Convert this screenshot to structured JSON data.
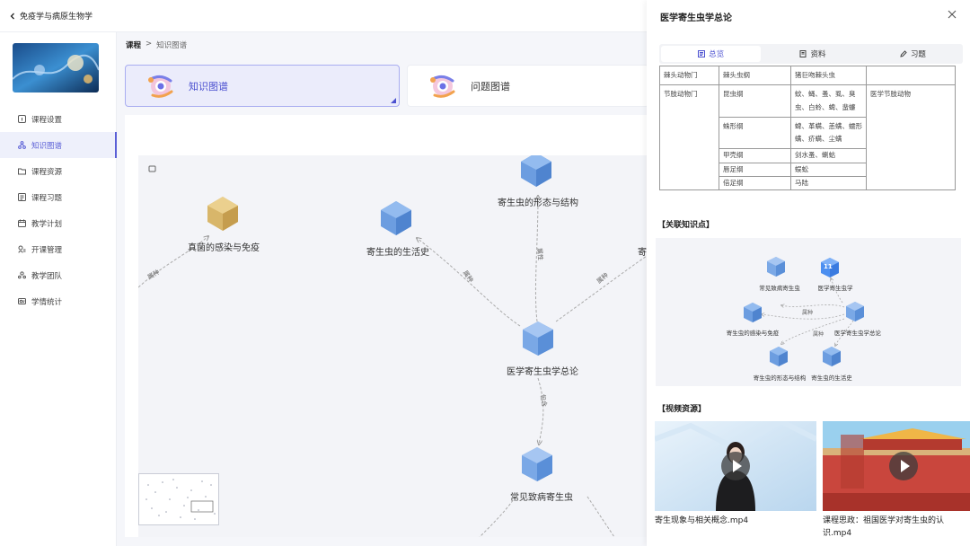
{
  "topbar": {
    "back_label": "免疫学与病原生物学"
  },
  "sidebar": {
    "items": [
      {
        "label": "课程设置",
        "icon": "info-square-icon"
      },
      {
        "label": "知识图谱",
        "icon": "graph-nodes-icon",
        "active": true
      },
      {
        "label": "课程资源",
        "icon": "folder-icon"
      },
      {
        "label": "课程习题",
        "icon": "list-doc-icon"
      },
      {
        "label": "教学计划",
        "icon": "calendar-icon"
      },
      {
        "label": "开课管理",
        "icon": "manage-icon"
      },
      {
        "label": "教学团队",
        "icon": "team-icon"
      },
      {
        "label": "学情统计",
        "icon": "stats-icon"
      }
    ]
  },
  "main": {
    "breadcrumb": [
      "课程",
      ">",
      "知识图谱"
    ],
    "cards": [
      {
        "label": "知识图谱",
        "active": true
      },
      {
        "label": "问题图谱"
      }
    ],
    "graph": {
      "nodes": [
        {
          "label": "真菌的感染与免疫"
        },
        {
          "label": "寄生虫的生活史"
        },
        {
          "label": "寄生虫的形态与结构"
        },
        {
          "label": "寄生"
        },
        {
          "label": "医学寄生虫学总论"
        },
        {
          "label": "常见致病寄生虫"
        }
      ],
      "edges": [
        "属种",
        "属种",
        "属性",
        "属种",
        "包含"
      ]
    }
  },
  "panel": {
    "title": "医学寄生虫学总论",
    "tabs": [
      {
        "label": "总览",
        "icon": "overview-icon",
        "active": true
      },
      {
        "label": "资料",
        "icon": "book-icon"
      },
      {
        "label": "习题",
        "icon": "pen-icon"
      }
    ],
    "table": {
      "rows": [
        [
          "棘头动物门",
          "棘头虫纲",
          "猪巨吻棘头虫",
          ""
        ],
        [
          "节肢动物门",
          "昆虫纲",
          "蚊、蝇、蚤、虱、臭虫、白蛉、蜱、蜚蠊",
          "医学节肢动物"
        ],
        [
          "",
          "蛛形纲",
          "蜱、革螨、恙螨、蠕形螨、疥螨、尘螨",
          ""
        ],
        [
          "",
          "甲壳纲",
          "剑水蚤、蝲蛄",
          ""
        ],
        [
          "",
          "唇足纲",
          "蜈蚣",
          ""
        ],
        [
          "",
          "倍足纲",
          "马陆",
          ""
        ]
      ]
    },
    "related_title": "【关联知识点】",
    "related": {
      "nodes": [
        {
          "label": "常见致病寄生虫"
        },
        {
          "label": "医学寄生虫学"
        },
        {
          "label": "寄生虫的感染与免疫"
        },
        {
          "label": "医学寄生虫学总论"
        },
        {
          "label": "寄生虫的形态与结构"
        },
        {
          "label": "寄生虫的生活史"
        }
      ],
      "badge": "11",
      "edges": [
        "属种",
        "属种"
      ]
    },
    "video_title": "【视频资源】",
    "videos": [
      {
        "title": "寄生现象与相关概念.mp4"
      },
      {
        "title": "课程思政：祖国医学对寄生虫的认识.mp4"
      }
    ]
  }
}
